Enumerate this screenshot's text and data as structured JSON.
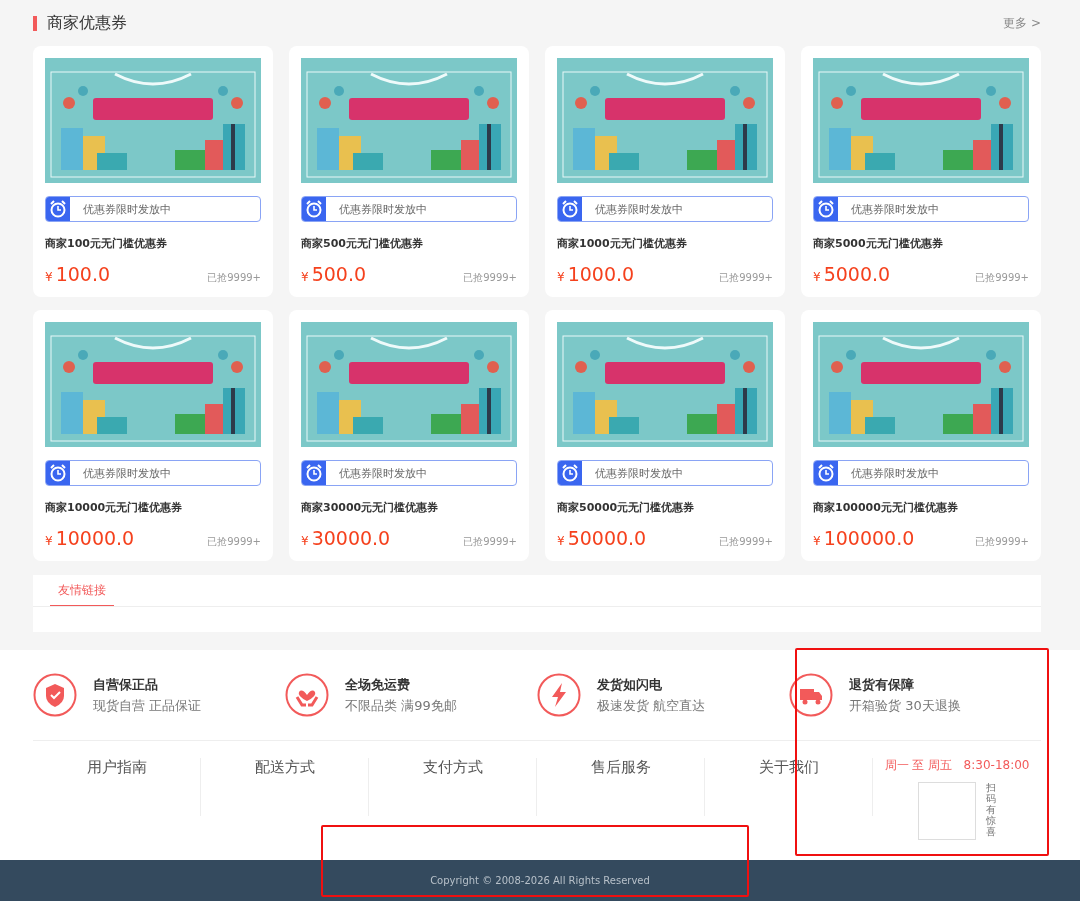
{
  "section": {
    "title": "商家优惠券",
    "more": "更多 >"
  },
  "coupons": [
    {
      "badge": "优惠券限时发放中",
      "name": "商家100元无门槛优惠券",
      "currency": "¥",
      "price": "100.0",
      "sold": "已抢9999+"
    },
    {
      "badge": "优惠券限时发放中",
      "name": "商家500元无门槛优惠券",
      "currency": "¥",
      "price": "500.0",
      "sold": "已抢9999+"
    },
    {
      "badge": "优惠券限时发放中",
      "name": "商家1000元无门槛优惠券",
      "currency": "¥",
      "price": "1000.0",
      "sold": "已抢9999+"
    },
    {
      "badge": "优惠券限时发放中",
      "name": "商家5000元无门槛优惠券",
      "currency": "¥",
      "price": "5000.0",
      "sold": "已抢9999+"
    },
    {
      "badge": "优惠券限时发放中",
      "name": "商家10000元无门槛优惠券",
      "currency": "¥",
      "price": "10000.0",
      "sold": "已抢9999+"
    },
    {
      "badge": "优惠券限时发放中",
      "name": "商家30000元无门槛优惠券",
      "currency": "¥",
      "price": "30000.0",
      "sold": "已抢9999+"
    },
    {
      "badge": "优惠券限时发放中",
      "name": "商家50000元无门槛优惠券",
      "currency": "¥",
      "price": "50000.0",
      "sold": "已抢9999+"
    },
    {
      "badge": "优惠券限时发放中",
      "name": "商家100000元无门槛优惠券",
      "currency": "¥",
      "price": "100000.0",
      "sold": "已抢9999+"
    }
  ],
  "friend_links": {
    "tabs": [
      {
        "label": "友情链接",
        "selected": true
      }
    ]
  },
  "features": [
    {
      "kind": "shield",
      "title": "自营保正品",
      "subtitle": "现货自营 正品保证"
    },
    {
      "kind": "heart",
      "title": "全场免运费",
      "subtitle": "不限品类 满99免邮"
    },
    {
      "kind": "bolt",
      "title": "发货如闪电",
      "subtitle": "极速发货 航空直达"
    },
    {
      "kind": "truck",
      "title": "退货有保障",
      "subtitle": "开箱验货 30天退换"
    }
  ],
  "footer_links": [
    "用户指南",
    "配送方式",
    "支付方式",
    "售后服务",
    "关于我们"
  ],
  "service": {
    "days": "周一 至 周五",
    "hours": "8:30-18:00",
    "qr_caption": "扫码有惊喜"
  },
  "copyright": "Copyright © 2008-2026 All Rights Reserved",
  "highlights": [
    {
      "kind": "box"
    },
    {
      "kind": "box"
    }
  ]
}
